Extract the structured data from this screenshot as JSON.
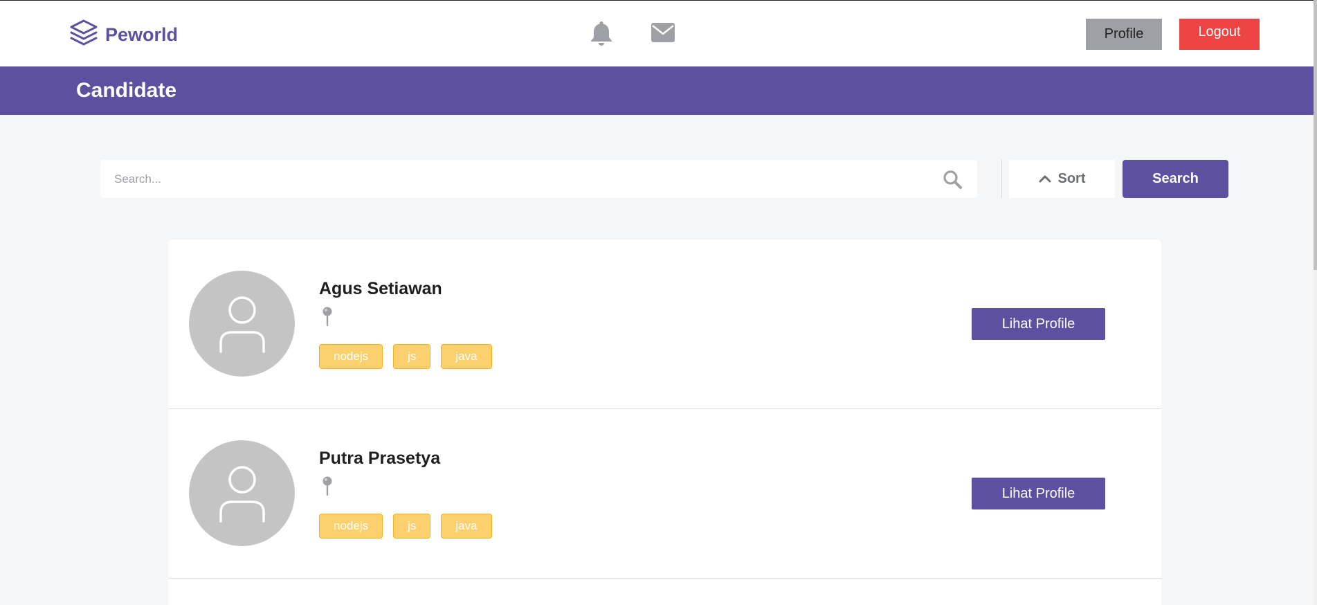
{
  "navbar": {
    "brand": "Peworld",
    "icons": [
      "bell-icon",
      "mail-icon"
    ],
    "profile_label": "Profile",
    "logout_label": "Logout"
  },
  "header": {
    "title": "Candidate"
  },
  "search": {
    "placeholder": "Search...",
    "value": "",
    "sort_label": "Sort",
    "search_label": "Search"
  },
  "candidates": [
    {
      "name": "Agus Setiawan",
      "location": "",
      "skills": [
        "nodejs",
        "js",
        "java"
      ],
      "action_label": "Lihat Profile"
    },
    {
      "name": "Putra Prasetya",
      "location": "",
      "skills": [
        "nodejs",
        "js",
        "java"
      ],
      "action_label": "Lihat Profile"
    }
  ],
  "colors": {
    "primary": "#5e50a1",
    "logout": "#ef4444",
    "profile_button": "#9ea0a5",
    "skill_bg": "#fbd06d",
    "skill_border": "#fbb017",
    "background": "#f5f6f8"
  }
}
